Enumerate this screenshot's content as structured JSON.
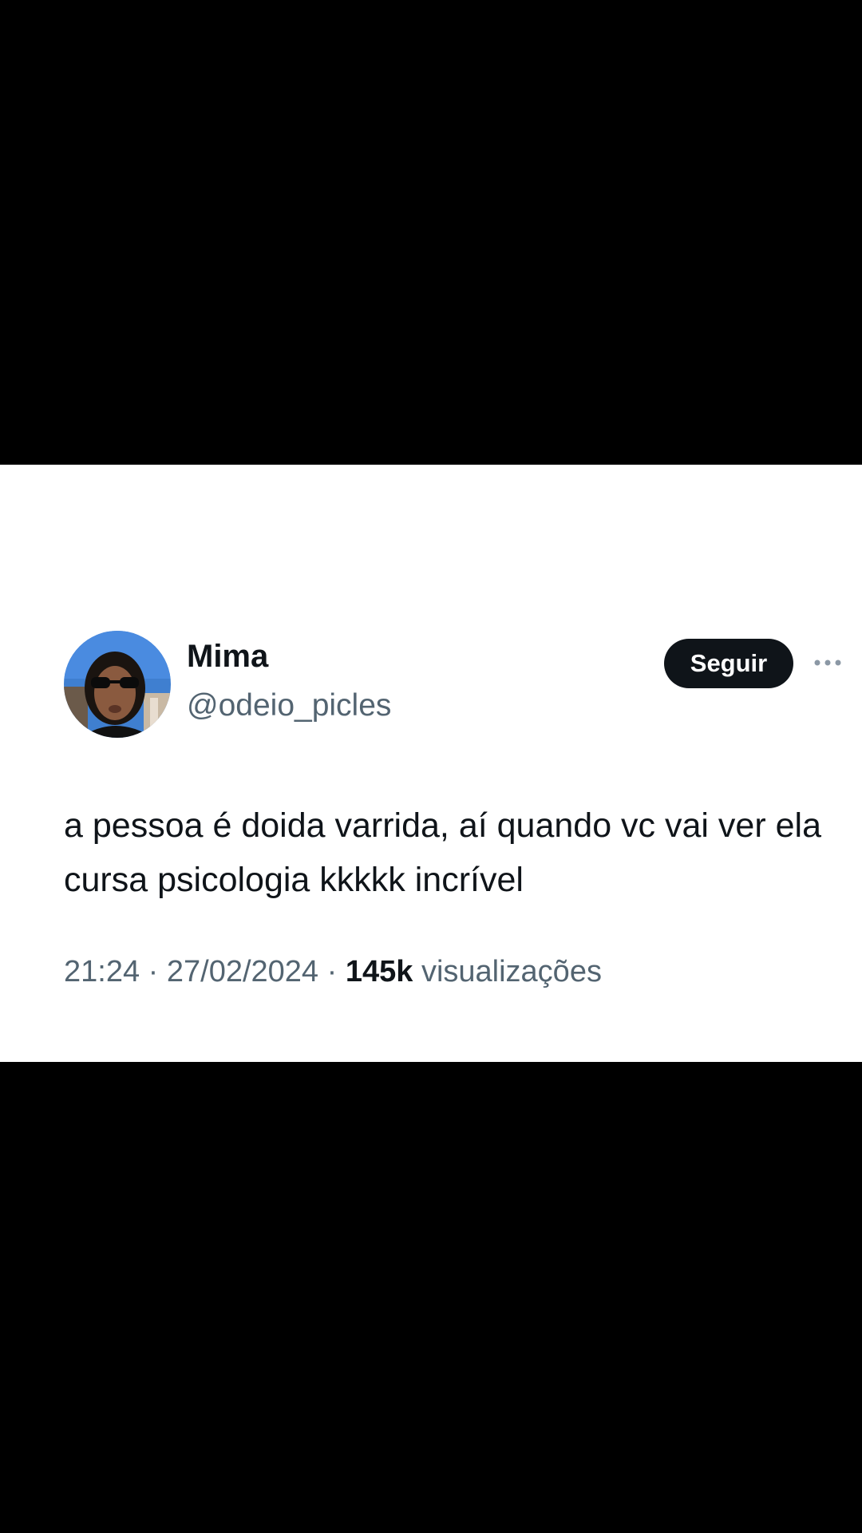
{
  "tweet": {
    "author": {
      "display_name": "Mima",
      "handle": "@odeio_picles"
    },
    "follow_label": "Seguir",
    "more_icon": "more-horizontal-icon",
    "text": "a pessoa é doida varrida, aí quando vc vai ver ela cursa psicologia kkkkk incrível",
    "time": "21:24",
    "separator": "·",
    "date": "27/02/2024",
    "views_count": "145k",
    "views_label": "visualizações"
  },
  "colors": {
    "background": "#000000",
    "card": "#ffffff",
    "primary_text": "#0f1419",
    "secondary_text": "#536471",
    "follow_button_bg": "#0f1419"
  }
}
